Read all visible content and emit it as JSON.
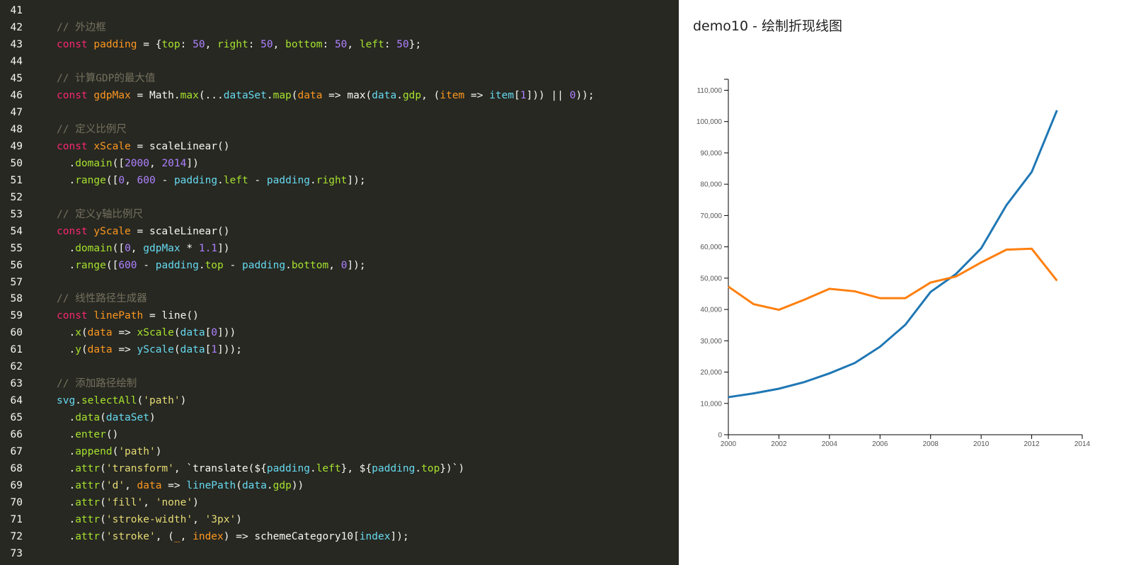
{
  "editor": {
    "lines": [
      {
        "num": "41",
        "tokens": []
      },
      {
        "num": "42",
        "tokens": [
          {
            "t": "// 外边框",
            "c": "c"
          }
        ]
      },
      {
        "num": "43",
        "tokens": [
          {
            "t": "const ",
            "c": "k"
          },
          {
            "t": "padding",
            "c": "v"
          },
          {
            "t": " = {",
            "c": "t"
          },
          {
            "t": "top",
            "c": "p"
          },
          {
            "t": ": ",
            "c": "t"
          },
          {
            "t": "50",
            "c": "n"
          },
          {
            "t": ", ",
            "c": "t"
          },
          {
            "t": "right",
            "c": "p"
          },
          {
            "t": ": ",
            "c": "t"
          },
          {
            "t": "50",
            "c": "n"
          },
          {
            "t": ", ",
            "c": "t"
          },
          {
            "t": "bottom",
            "c": "p"
          },
          {
            "t": ": ",
            "c": "t"
          },
          {
            "t": "50",
            "c": "n"
          },
          {
            "t": ", ",
            "c": "t"
          },
          {
            "t": "left",
            "c": "p"
          },
          {
            "t": ": ",
            "c": "t"
          },
          {
            "t": "50",
            "c": "n"
          },
          {
            "t": "};",
            "c": "t"
          }
        ]
      },
      {
        "num": "44",
        "tokens": []
      },
      {
        "num": "45",
        "tokens": [
          {
            "t": "// 计算GDP的最大值",
            "c": "c"
          }
        ]
      },
      {
        "num": "46",
        "tokens": [
          {
            "t": "const ",
            "c": "k"
          },
          {
            "t": "gdpMax",
            "c": "v"
          },
          {
            "t": " = Math.",
            "c": "t"
          },
          {
            "t": "max",
            "c": "p"
          },
          {
            "t": "(...",
            "c": "t"
          },
          {
            "t": "dataSet",
            "c": "i"
          },
          {
            "t": ".",
            "c": "t"
          },
          {
            "t": "map",
            "c": "p"
          },
          {
            "t": "(",
            "c": "t"
          },
          {
            "t": "data",
            "c": "v"
          },
          {
            "t": " => max(",
            "c": "t"
          },
          {
            "t": "data",
            "c": "i"
          },
          {
            "t": ".",
            "c": "t"
          },
          {
            "t": "gdp",
            "c": "p"
          },
          {
            "t": ", (",
            "c": "t"
          },
          {
            "t": "item",
            "c": "v"
          },
          {
            "t": " => ",
            "c": "t"
          },
          {
            "t": "item",
            "c": "i"
          },
          {
            "t": "[",
            "c": "t"
          },
          {
            "t": "1",
            "c": "n"
          },
          {
            "t": "])) || ",
            "c": "t"
          },
          {
            "t": "0",
            "c": "n"
          },
          {
            "t": "));",
            "c": "t"
          }
        ]
      },
      {
        "num": "47",
        "tokens": []
      },
      {
        "num": "48",
        "tokens": [
          {
            "t": "// 定义比例尺",
            "c": "c"
          }
        ]
      },
      {
        "num": "49",
        "tokens": [
          {
            "t": "const ",
            "c": "k"
          },
          {
            "t": "xScale",
            "c": "v"
          },
          {
            "t": " = scaleLinear()",
            "c": "t"
          }
        ]
      },
      {
        "num": "50",
        "tokens": [
          {
            "t": "  .",
            "c": "t"
          },
          {
            "t": "domain",
            "c": "p"
          },
          {
            "t": "([",
            "c": "t"
          },
          {
            "t": "2000",
            "c": "n"
          },
          {
            "t": ", ",
            "c": "t"
          },
          {
            "t": "2014",
            "c": "n"
          },
          {
            "t": "])",
            "c": "t"
          }
        ]
      },
      {
        "num": "51",
        "tokens": [
          {
            "t": "  .",
            "c": "t"
          },
          {
            "t": "range",
            "c": "p"
          },
          {
            "t": "([",
            "c": "t"
          },
          {
            "t": "0",
            "c": "n"
          },
          {
            "t": ", ",
            "c": "t"
          },
          {
            "t": "600",
            "c": "n"
          },
          {
            "t": " - ",
            "c": "t"
          },
          {
            "t": "padding",
            "c": "i"
          },
          {
            "t": ".",
            "c": "t"
          },
          {
            "t": "left",
            "c": "p"
          },
          {
            "t": " - ",
            "c": "t"
          },
          {
            "t": "padding",
            "c": "i"
          },
          {
            "t": ".",
            "c": "t"
          },
          {
            "t": "right",
            "c": "p"
          },
          {
            "t": "]);",
            "c": "t"
          }
        ]
      },
      {
        "num": "52",
        "tokens": []
      },
      {
        "num": "53",
        "tokens": [
          {
            "t": "// 定义y轴比例尺",
            "c": "c"
          }
        ]
      },
      {
        "num": "54",
        "tokens": [
          {
            "t": "const ",
            "c": "k"
          },
          {
            "t": "yScale",
            "c": "v"
          },
          {
            "t": " = scaleLinear()",
            "c": "t"
          }
        ]
      },
      {
        "num": "55",
        "tokens": [
          {
            "t": "  .",
            "c": "t"
          },
          {
            "t": "domain",
            "c": "p"
          },
          {
            "t": "([",
            "c": "t"
          },
          {
            "t": "0",
            "c": "n"
          },
          {
            "t": ", ",
            "c": "t"
          },
          {
            "t": "gdpMax",
            "c": "i"
          },
          {
            "t": " * ",
            "c": "t"
          },
          {
            "t": "1.1",
            "c": "n"
          },
          {
            "t": "])",
            "c": "t"
          }
        ]
      },
      {
        "num": "56",
        "tokens": [
          {
            "t": "  .",
            "c": "t"
          },
          {
            "t": "range",
            "c": "p"
          },
          {
            "t": "([",
            "c": "t"
          },
          {
            "t": "600",
            "c": "n"
          },
          {
            "t": " - ",
            "c": "t"
          },
          {
            "t": "padding",
            "c": "i"
          },
          {
            "t": ".",
            "c": "t"
          },
          {
            "t": "top",
            "c": "p"
          },
          {
            "t": " - ",
            "c": "t"
          },
          {
            "t": "padding",
            "c": "i"
          },
          {
            "t": ".",
            "c": "t"
          },
          {
            "t": "bottom",
            "c": "p"
          },
          {
            "t": ", ",
            "c": "t"
          },
          {
            "t": "0",
            "c": "n"
          },
          {
            "t": "]);",
            "c": "t"
          }
        ]
      },
      {
        "num": "57",
        "tokens": []
      },
      {
        "num": "58",
        "tokens": [
          {
            "t": "// 线性路径生成器",
            "c": "c"
          }
        ]
      },
      {
        "num": "59",
        "tokens": [
          {
            "t": "const ",
            "c": "k"
          },
          {
            "t": "linePath",
            "c": "v"
          },
          {
            "t": " = line()",
            "c": "t"
          }
        ]
      },
      {
        "num": "60",
        "tokens": [
          {
            "t": "  .",
            "c": "t"
          },
          {
            "t": "x",
            "c": "p"
          },
          {
            "t": "(",
            "c": "t"
          },
          {
            "t": "data",
            "c": "v"
          },
          {
            "t": " => ",
            "c": "t"
          },
          {
            "t": "xScale",
            "c": "p"
          },
          {
            "t": "(",
            "c": "t"
          },
          {
            "t": "data",
            "c": "i"
          },
          {
            "t": "[",
            "c": "t"
          },
          {
            "t": "0",
            "c": "n"
          },
          {
            "t": "]))",
            "c": "t"
          }
        ]
      },
      {
        "num": "61",
        "tokens": [
          {
            "t": "  .",
            "c": "t"
          },
          {
            "t": "y",
            "c": "p"
          },
          {
            "t": "(",
            "c": "t"
          },
          {
            "t": "data",
            "c": "v"
          },
          {
            "t": " => ",
            "c": "t"
          },
          {
            "t": "yScale",
            "c": "i"
          },
          {
            "t": "(",
            "c": "t"
          },
          {
            "t": "data",
            "c": "i"
          },
          {
            "t": "[",
            "c": "t"
          },
          {
            "t": "1",
            "c": "n"
          },
          {
            "t": "]));",
            "c": "t"
          }
        ]
      },
      {
        "num": "62",
        "tokens": []
      },
      {
        "num": "63",
        "tokens": [
          {
            "t": "// 添加路径绘制",
            "c": "c"
          }
        ]
      },
      {
        "num": "64",
        "tokens": [
          {
            "t": "svg",
            "c": "i"
          },
          {
            "t": ".",
            "c": "t"
          },
          {
            "t": "selectAll",
            "c": "p"
          },
          {
            "t": "(",
            "c": "t"
          },
          {
            "t": "'path'",
            "c": "s"
          },
          {
            "t": ")",
            "c": "t"
          }
        ]
      },
      {
        "num": "65",
        "tokens": [
          {
            "t": "  .",
            "c": "t"
          },
          {
            "t": "data",
            "c": "p"
          },
          {
            "t": "(",
            "c": "t"
          },
          {
            "t": "dataSet",
            "c": "i"
          },
          {
            "t": ")",
            "c": "t"
          }
        ]
      },
      {
        "num": "66",
        "tokens": [
          {
            "t": "  .",
            "c": "t"
          },
          {
            "t": "enter",
            "c": "p"
          },
          {
            "t": "()",
            "c": "t"
          }
        ]
      },
      {
        "num": "67",
        "tokens": [
          {
            "t": "  .",
            "c": "t"
          },
          {
            "t": "append",
            "c": "p"
          },
          {
            "t": "(",
            "c": "t"
          },
          {
            "t": "'path'",
            "c": "s"
          },
          {
            "t": ")",
            "c": "t"
          }
        ]
      },
      {
        "num": "68",
        "tokens": [
          {
            "t": "  .",
            "c": "t"
          },
          {
            "t": "attr",
            "c": "p"
          },
          {
            "t": "(",
            "c": "t"
          },
          {
            "t": "'transform'",
            "c": "s"
          },
          {
            "t": ", `translate(${",
            "c": "t"
          },
          {
            "t": "padding",
            "c": "i"
          },
          {
            "t": ".",
            "c": "t"
          },
          {
            "t": "left",
            "c": "p"
          },
          {
            "t": "}, ${",
            "c": "t"
          },
          {
            "t": "padding",
            "c": "i"
          },
          {
            "t": ".",
            "c": "t"
          },
          {
            "t": "top",
            "c": "p"
          },
          {
            "t": "})`)",
            "c": "t"
          }
        ]
      },
      {
        "num": "69",
        "tokens": [
          {
            "t": "  .",
            "c": "t"
          },
          {
            "t": "attr",
            "c": "p"
          },
          {
            "t": "(",
            "c": "t"
          },
          {
            "t": "'d'",
            "c": "s"
          },
          {
            "t": ", ",
            "c": "t"
          },
          {
            "t": "data",
            "c": "v"
          },
          {
            "t": " => ",
            "c": "t"
          },
          {
            "t": "linePath",
            "c": "i"
          },
          {
            "t": "(",
            "c": "t"
          },
          {
            "t": "data",
            "c": "i"
          },
          {
            "t": ".",
            "c": "t"
          },
          {
            "t": "gdp",
            "c": "p"
          },
          {
            "t": "))",
            "c": "t"
          }
        ]
      },
      {
        "num": "70",
        "tokens": [
          {
            "t": "  .",
            "c": "t"
          },
          {
            "t": "attr",
            "c": "p"
          },
          {
            "t": "(",
            "c": "t"
          },
          {
            "t": "'fill'",
            "c": "s"
          },
          {
            "t": ", ",
            "c": "t"
          },
          {
            "t": "'none'",
            "c": "s"
          },
          {
            "t": ")",
            "c": "t"
          }
        ]
      },
      {
        "num": "71",
        "tokens": [
          {
            "t": "  .",
            "c": "t"
          },
          {
            "t": "attr",
            "c": "p"
          },
          {
            "t": "(",
            "c": "t"
          },
          {
            "t": "'stroke-width'",
            "c": "s"
          },
          {
            "t": ", ",
            "c": "t"
          },
          {
            "t": "'3px'",
            "c": "s"
          },
          {
            "t": ")",
            "c": "t"
          }
        ]
      },
      {
        "num": "72",
        "tokens": [
          {
            "t": "  .",
            "c": "t"
          },
          {
            "t": "attr",
            "c": "p"
          },
          {
            "t": "(",
            "c": "t"
          },
          {
            "t": "'stroke'",
            "c": "s"
          },
          {
            "t": ", (",
            "c": "t"
          },
          {
            "t": "_",
            "c": "v"
          },
          {
            "t": ", ",
            "c": "t"
          },
          {
            "t": "index",
            "c": "v"
          },
          {
            "t": ") => schemeCategory10[",
            "c": "t"
          },
          {
            "t": "index",
            "c": "i"
          },
          {
            "t": "]);",
            "c": "t"
          }
        ]
      },
      {
        "num": "73",
        "tokens": []
      }
    ]
  },
  "preview": {
    "title": "demo10 - 绘制折现线图"
  },
  "chart_data": {
    "type": "line",
    "title": "",
    "xlabel": "",
    "ylabel": "",
    "xlim": [
      2000,
      2014
    ],
    "ylim": [
      0,
      113500
    ],
    "x_ticks": [
      "2000",
      "2002",
      "2004",
      "2006",
      "2008",
      "2010",
      "2012",
      "2014"
    ],
    "y_ticks": [
      "0",
      "10,000",
      "20,000",
      "30,000",
      "40,000",
      "50,000",
      "60,000",
      "70,000",
      "80,000",
      "90,000",
      "100,000",
      "110,000"
    ],
    "grid": false,
    "series": [
      {
        "color": "#1f77b4",
        "x": [
          2000,
          2001,
          2002,
          2003,
          2004,
          2005,
          2006,
          2007,
          2008,
          2009,
          2010,
          2011,
          2012,
          2013
        ],
        "values": [
          12000,
          13200,
          14700,
          16800,
          19600,
          22900,
          28100,
          35100,
          45600,
          51300,
          59500,
          73300,
          83900,
          103600
        ]
      },
      {
        "color": "#ff7f0e",
        "x": [
          2000,
          2001,
          2002,
          2003,
          2004,
          2005,
          2006,
          2007,
          2008,
          2009,
          2010,
          2011,
          2012,
          2013
        ],
        "values": [
          47300,
          41700,
          39900,
          43100,
          46600,
          45800,
          43600,
          43600,
          48600,
          50500,
          55000,
          59100,
          59400,
          49200
        ]
      }
    ]
  }
}
